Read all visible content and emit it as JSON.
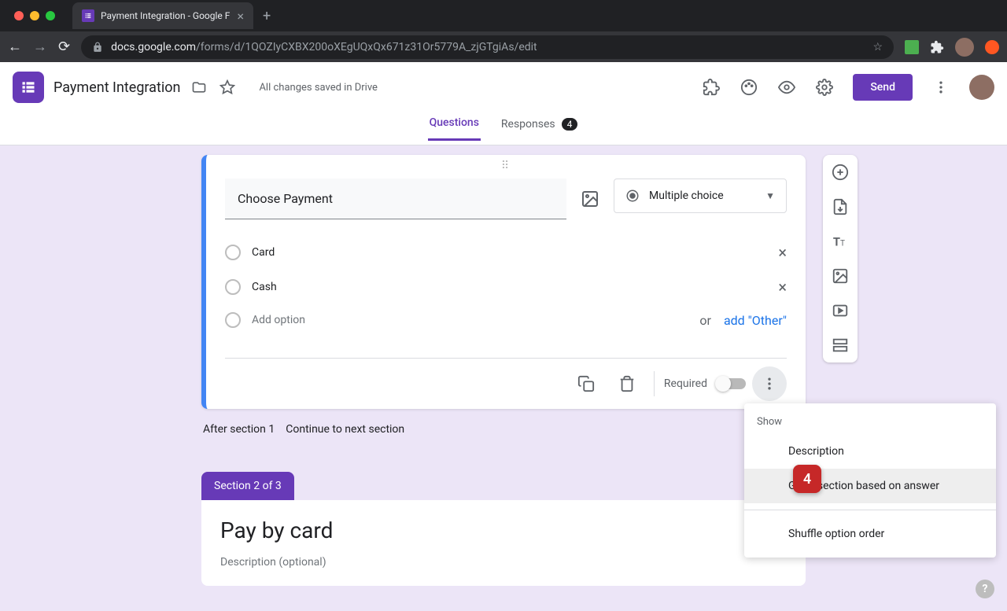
{
  "browser": {
    "tab_title": "Payment Integration - Google F",
    "url_domain": "docs.google.com",
    "url_path": "/forms/d/1QOZIyCXBX200oXEgUQxQx671z31Or5779A_zjGTgiAs/edit"
  },
  "header": {
    "form_title": "Payment Integration",
    "save_status": "All changes saved in Drive",
    "send_button": "Send"
  },
  "tabs": {
    "questions": "Questions",
    "responses": "Responses",
    "responses_count": "4"
  },
  "question": {
    "title": "Choose Payment",
    "type": "Multiple choice",
    "options": [
      "Card",
      "Cash"
    ],
    "add_option": "Add option",
    "or": "or",
    "add_other": "add \"Other\"",
    "required_label": "Required"
  },
  "after_section": {
    "label": "After section 1",
    "action": "Continue to next section"
  },
  "section2": {
    "label": "Section 2 of 3",
    "title": "Pay by card",
    "description": "Description (optional)"
  },
  "popup": {
    "show": "Show",
    "description": "Description",
    "goto": "Go to section based on answer",
    "shuffle": "Shuffle option order"
  },
  "annotation": {
    "number": "4"
  }
}
